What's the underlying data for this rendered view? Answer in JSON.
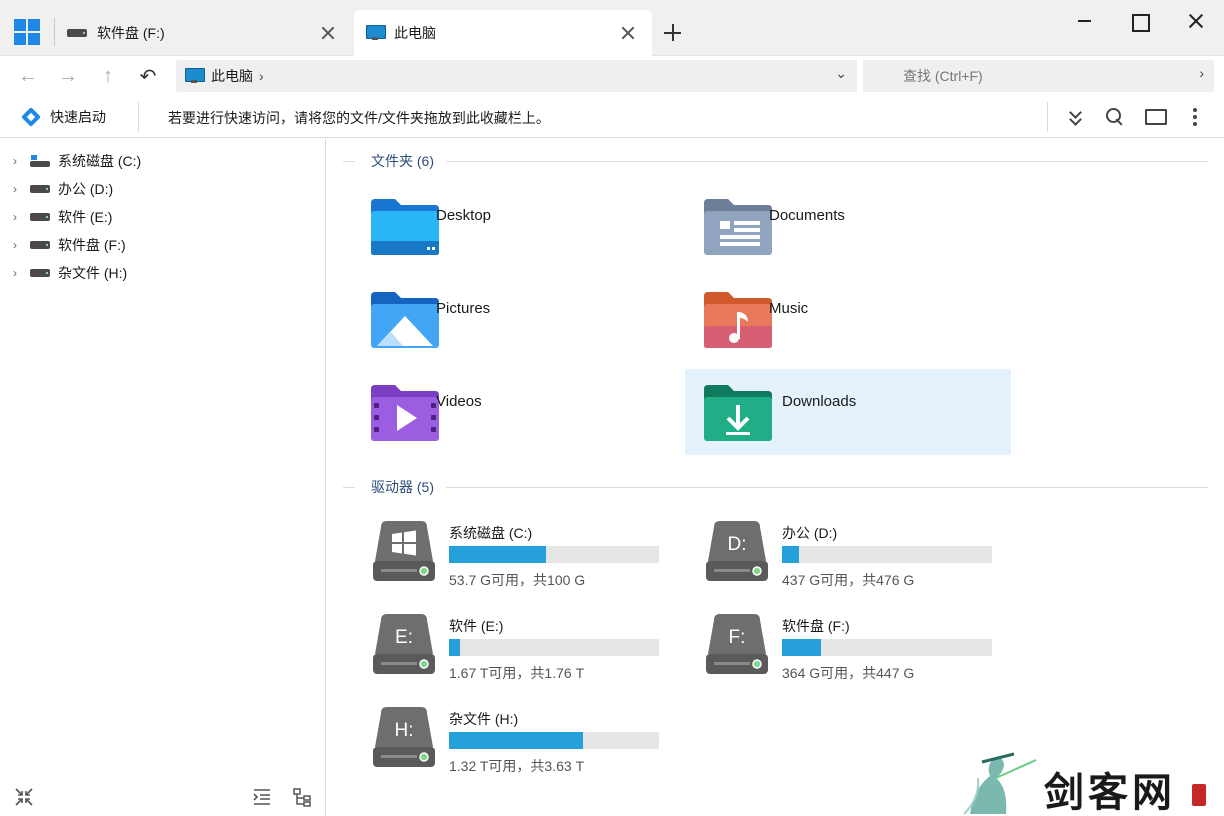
{
  "tabs": [
    {
      "label": "软件盘 (F:)",
      "icon": "drive-icon",
      "active": false
    },
    {
      "label": "此电脑",
      "icon": "this-pc-icon",
      "active": true
    }
  ],
  "address": {
    "crumb": "此电脑",
    "chevron": "›",
    "dropdown": "⌄"
  },
  "search": {
    "placeholder": "查找 (Ctrl+F)",
    "go": "›"
  },
  "nav": {
    "back": "←",
    "forward": "→",
    "up": "↑",
    "refresh": "↶"
  },
  "quickbar": {
    "quick_access_label": "快速启动",
    "hint": "若要进行快速访问，请将您的文件/文件夹拖放到此收藏栏上。"
  },
  "sidebar": {
    "items": [
      {
        "label": "系统磁盘 (C:)",
        "icon": "windows-drive-icon"
      },
      {
        "label": "办公 (D:)",
        "icon": "drive-icon"
      },
      {
        "label": "软件 (E:)",
        "icon": "drive-icon"
      },
      {
        "label": "软件盘 (F:)",
        "icon": "drive-icon"
      },
      {
        "label": "杂文件 (H:)",
        "icon": "drive-icon"
      }
    ],
    "expander": "›"
  },
  "folders_section": {
    "title": "文件夹 (6)"
  },
  "folders": [
    {
      "name": "Desktop",
      "icon": "desktop-folder-icon"
    },
    {
      "name": "Documents",
      "icon": "documents-folder-icon"
    },
    {
      "name": "Pictures",
      "icon": "pictures-folder-icon"
    },
    {
      "name": "Music",
      "icon": "music-folder-icon"
    },
    {
      "name": "Videos",
      "icon": "videos-folder-icon"
    },
    {
      "name": "Downloads",
      "icon": "downloads-folder-icon",
      "selected": true
    }
  ],
  "drives_section": {
    "title": "驱动器 (5)"
  },
  "drives": [
    {
      "name": "系统磁盘 (C:)",
      "letter": "",
      "info": "53.7 G可用，共100 G",
      "used_fraction": 0.463
    },
    {
      "name": "办公 (D:)",
      "letter": "D:",
      "info": "437 G可用，共476 G",
      "used_fraction": 0.082
    },
    {
      "name": "软件 (E:)",
      "letter": "E:",
      "info": "1.67 T可用，共1.76 T",
      "used_fraction": 0.051
    },
    {
      "name": "软件盘 (F:)",
      "letter": "F:",
      "info": "364 G可用，共447 G",
      "used_fraction": 0.186
    },
    {
      "name": "杂文件 (H:)",
      "letter": "H:",
      "info": "1.32 T可用，共3.63 T",
      "used_fraction": 0.636
    }
  ],
  "watermark": {
    "text": "剑客网"
  },
  "colors": {
    "accent": "#1e88e5",
    "bar_fill": "#26a0da",
    "selected_bg": "#e5f1fb",
    "section_title": "#2c4d7a"
  }
}
